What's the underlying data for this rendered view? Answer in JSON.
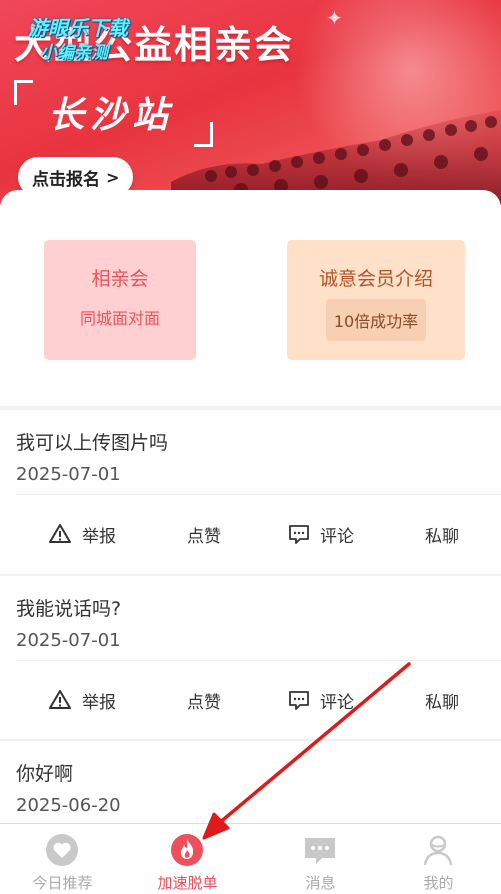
{
  "banner": {
    "title": "大型公益相亲会",
    "city": "长沙站",
    "signup_label": "点击报名",
    "watermark_line1": "游眼乐下载",
    "watermark_line2": "小编亲测"
  },
  "features": {
    "left": {
      "title": "相亲会",
      "subtitle": "同城面对面"
    },
    "right": {
      "title": "诚意会员介绍",
      "subtitle": "10倍成功率"
    }
  },
  "posts": [
    {
      "title": "我可以上传图片吗",
      "date": "2025-07-01"
    },
    {
      "title": "我能说话吗?",
      "date": "2025-07-01"
    },
    {
      "title": "你好啊",
      "date": "2025-06-20"
    }
  ],
  "actions": {
    "report": "举报",
    "like": "点赞",
    "comment": "评论",
    "private_chat": "私聊"
  },
  "nav": {
    "today": "今日推荐",
    "speed": "加速脱单",
    "messages": "消息",
    "mine": "我的"
  },
  "colors": {
    "accent": "#ef4f58",
    "banner_red": "#e8343f",
    "pink_tile": "#ffd0d2",
    "peach_tile": "#ffe0c8",
    "annotation_arrow": "#e01919"
  },
  "icons": {
    "report": "warning-triangle-icon",
    "comment": "comment-bubble-icon",
    "today": "heart-icon",
    "speed": "flame-icon",
    "messages": "chat-icon",
    "mine": "user-icon"
  }
}
